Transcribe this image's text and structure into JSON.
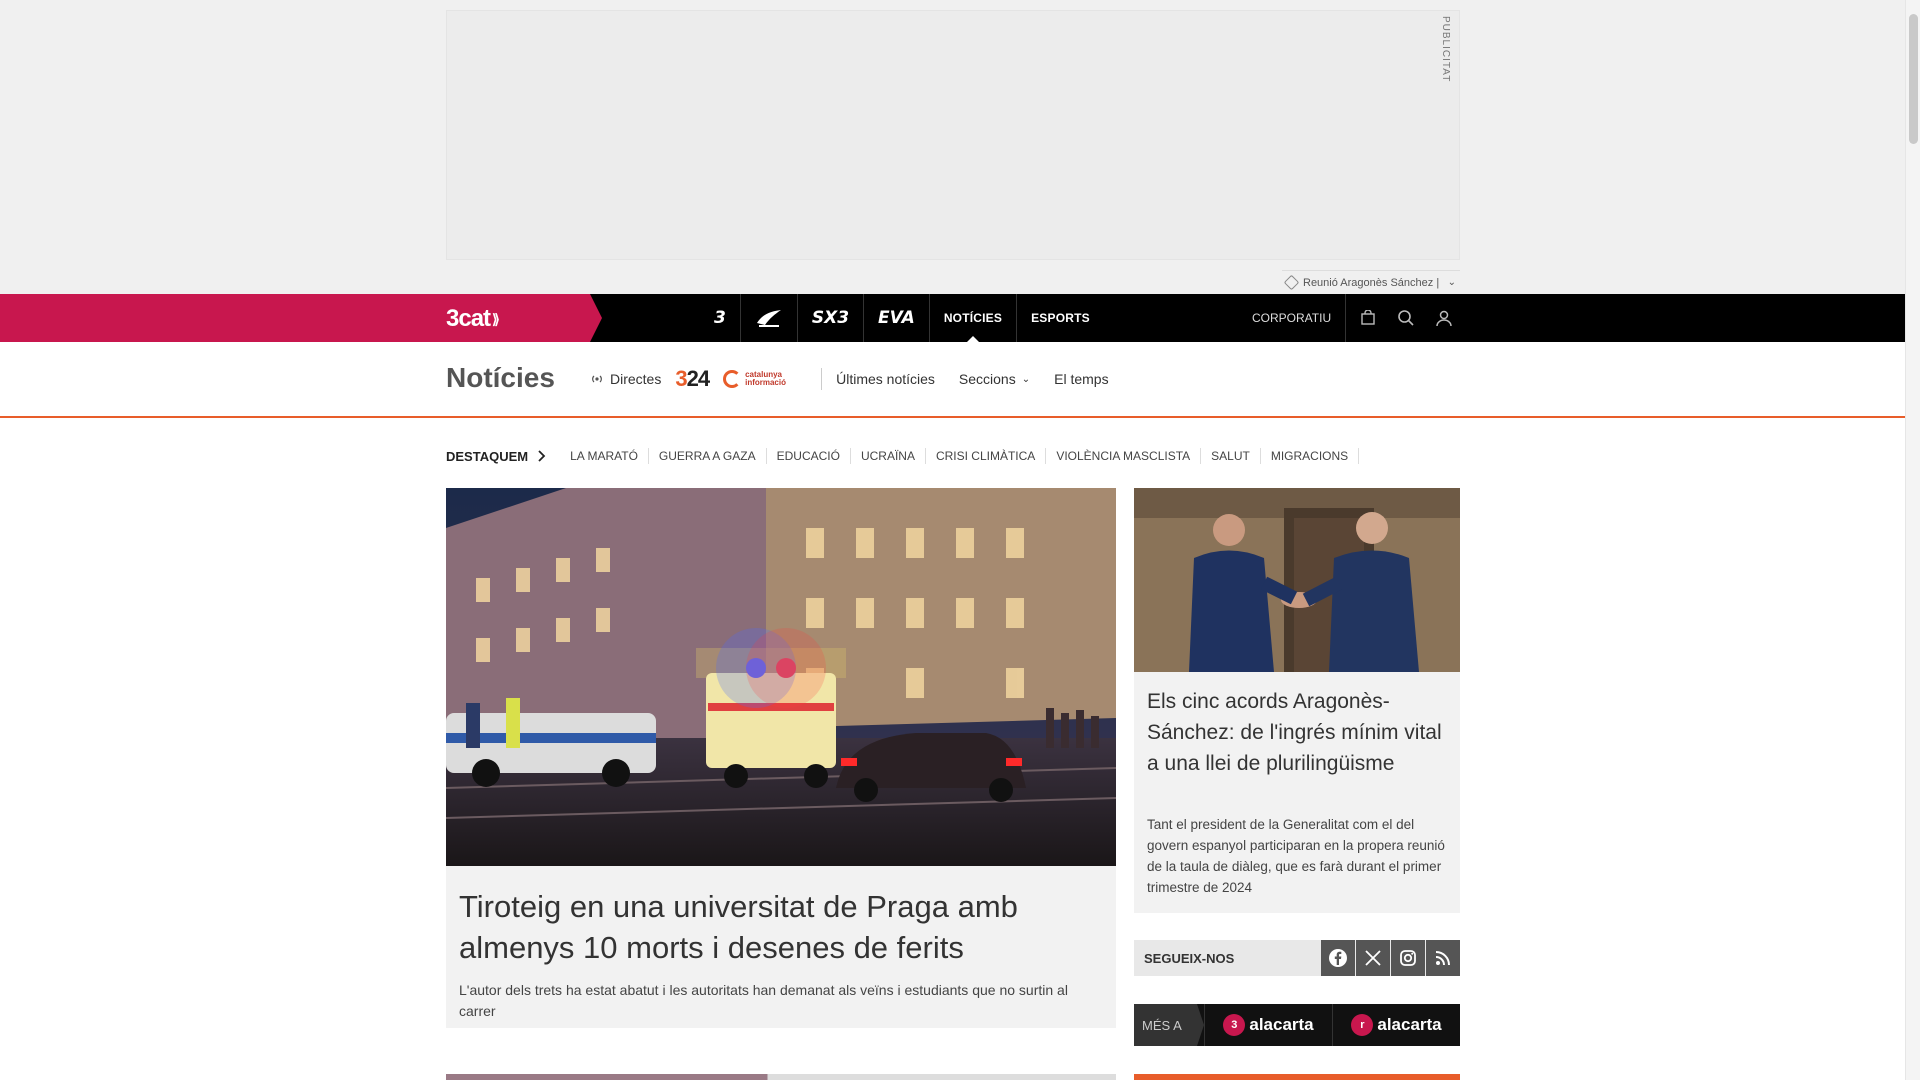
{
  "ad": {
    "label": "PUBLICITAT",
    "tag": "Reunió Aragonès Sánchez |"
  },
  "topnav": {
    "brand": "3cat",
    "channels": [
      {
        "label": "3",
        "type": "logo"
      },
      {
        "label": "Cat ràdio",
        "type": "logo"
      },
      {
        "label": "SX3",
        "type": "logo"
      },
      {
        "label": "EVA",
        "type": "logo"
      },
      {
        "label": "NOTÍCIES",
        "type": "text"
      },
      {
        "label": "ESPORTS",
        "type": "text"
      }
    ],
    "corporate": "CORPORATIU"
  },
  "section": {
    "title": "Notícies",
    "live": "Directes",
    "logo_324": "324",
    "logo_ci": "catalunya informació",
    "latest": "Últimes notícies",
    "sections": "Seccions",
    "weather": "El temps"
  },
  "highlights": {
    "label": "DESTAQUEM",
    "tags": [
      "LA MARATÓ",
      "GUERRA A GAZA",
      "EDUCACIÓ",
      "UCRAÏNA",
      "CRISI CLIMÀTICA",
      "VIOLÈNCIA MASCLISTA",
      "SALUT",
      "MIGRACIONS"
    ]
  },
  "main_article": {
    "title": "Tiroteig en una universitat de Praga amb almenys 10 morts i desenes de ferits",
    "summary": "L'autor dels trets ha estat abatut i les autoritats han demanat als veïns i estudiants que no surtin al carrer",
    "image_alt": "Police cars and ambulance on a Prague street at night"
  },
  "side_article": {
    "title": "Els cinc acords Aragonès-Sánchez: de l'ingrés mínim vital a una llei de plurilingüisme",
    "summary": "Tant el president de la Generalitat com el del govern espanyol participaran en la propera reunió de la taula de diàleg, que es farà durant el primer trimestre de 2024",
    "image_alt": "Two politicians shaking hands"
  },
  "follow": {
    "label": "SEGUEIX-NOS",
    "networks": [
      "facebook",
      "x",
      "instagram",
      "rss"
    ]
  },
  "more": {
    "label": "MÉS A",
    "items": [
      {
        "badge": "3",
        "label": "alacarta"
      },
      {
        "badge": "r",
        "label": "alacarta"
      }
    ]
  },
  "colors": {
    "brand": "#c8174e",
    "accent": "#e85d2a",
    "nav": "#000000"
  }
}
